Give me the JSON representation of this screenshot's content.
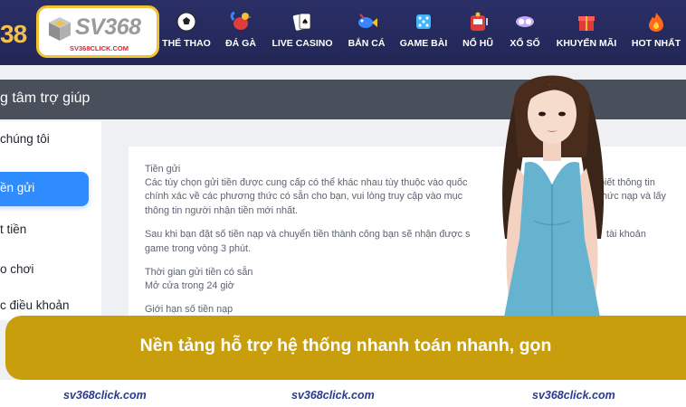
{
  "header": {
    "logo_partial": "38",
    "logo_text": "SV368",
    "logo_url": "SV368CLICK.COM",
    "nav": [
      {
        "label": "THỂ THAO",
        "icon": "soccer-ball-icon"
      },
      {
        "label": "ĐÁ GÀ",
        "icon": "rooster-icon"
      },
      {
        "label": "LIVE CASINO",
        "icon": "playing-cards-icon"
      },
      {
        "label": "BẮN CÁ",
        "icon": "fish-icon"
      },
      {
        "label": "GAME BÀI",
        "icon": "dice-icon"
      },
      {
        "label": "NỔ HŨ",
        "icon": "slot-machine-icon"
      },
      {
        "label": "XỔ SỐ",
        "icon": "lottery-balls-icon"
      },
      {
        "label": "KHUYẾN MÃI",
        "icon": "gift-icon"
      },
      {
        "label": "HOT NHẤT",
        "icon": "fire-icon"
      }
    ]
  },
  "help": {
    "title": "g tâm trợ giúp"
  },
  "sidebar": {
    "items": [
      {
        "label": "chúng tôi",
        "active": false
      },
      {
        "label": "ền gửi",
        "active": true
      },
      {
        "label": "t tiền",
        "active": false
      },
      {
        "label": "o chơi",
        "active": false
      },
      {
        "label": "c điều khoản",
        "active": false
      }
    ]
  },
  "content": {
    "lines": [
      "Tiền gửi",
      "Các tùy chọn gửi tiền được cung cấp có thể khác nhau tùy thuộc vào quốc",
      "chính xác về các phương thức có sẵn cho bạn, vui lòng truy cập vào mục",
      "thông tin người nhận tiền mới nhất.",
      "Sau khi bạn đặt số tiền nạp và chuyển tiền thành công bạn sẽ nhận được s",
      "game trong vòng 3 phút.",
      "Thời gian gửi tiền có sẵn",
      "Mở cửa trong 24 giờ",
      "Giới hạn số tiền nạp"
    ],
    "right_fragments": [
      "biết thông tin",
      "thức nạp và lấy",
      "tài khoản"
    ]
  },
  "banner": {
    "text": "Nền tảng hỗ trợ hệ thống nhanh toán nhanh, gọn"
  },
  "footer": {
    "links": [
      "sv368click.com",
      "sv368click.com",
      "sv368click.com"
    ]
  },
  "colors": {
    "nav_bg": "#252a5e",
    "logo_border": "#f1c232",
    "banner": "#c99e0c",
    "active_item": "#2f8cff",
    "footer_link": "#2a3a8c"
  }
}
